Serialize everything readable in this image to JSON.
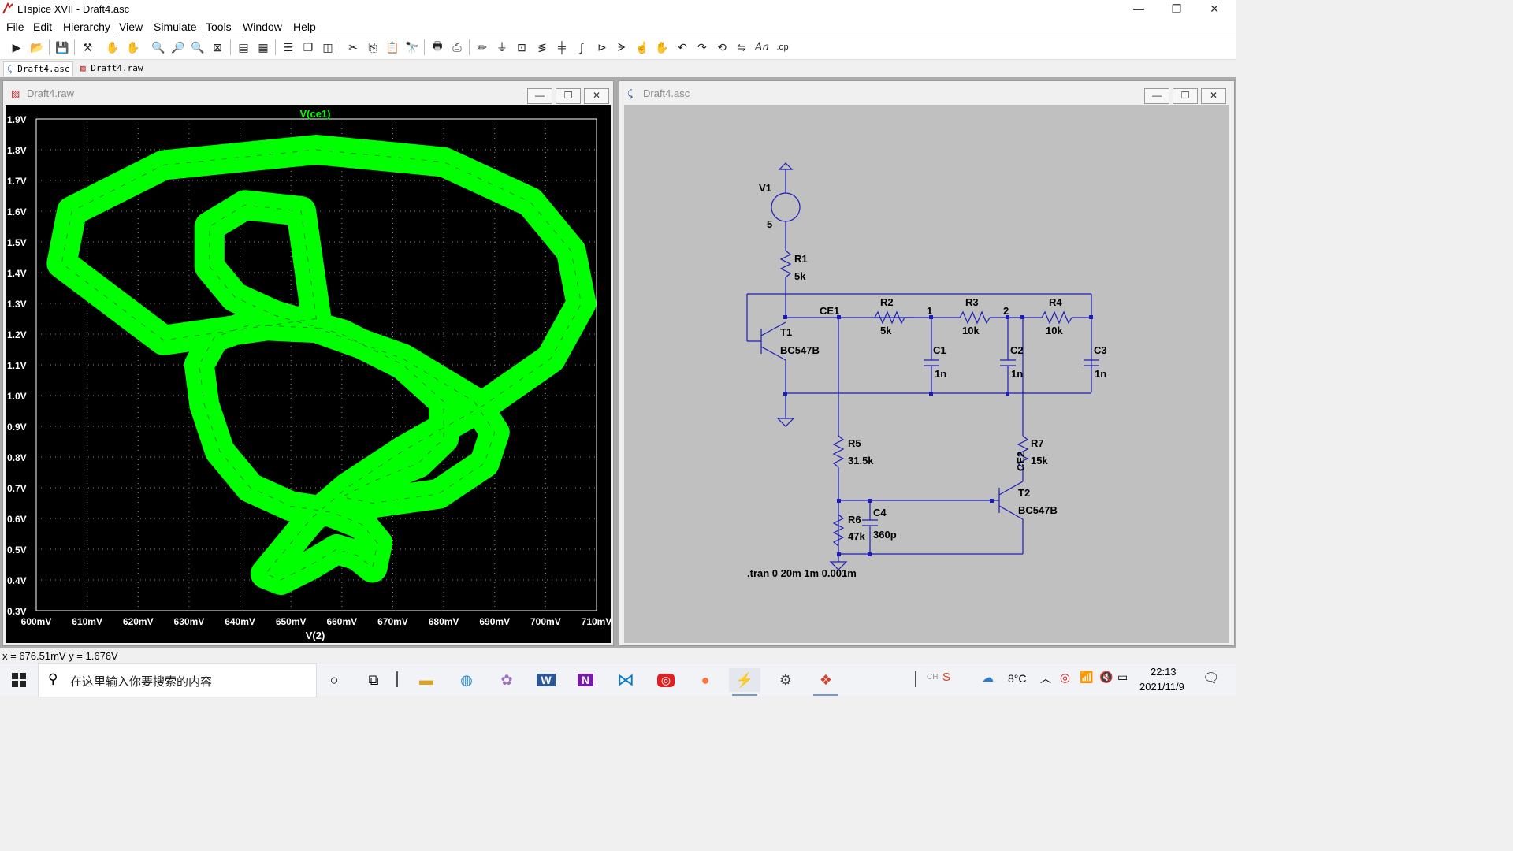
{
  "window": {
    "title": "LTspice XVII - Draft4.asc",
    "controls": [
      "—",
      "❐",
      "✕"
    ]
  },
  "menu": [
    {
      "key": "F",
      "rest": "ile"
    },
    {
      "key": "E",
      "rest": "dit"
    },
    {
      "key": "H",
      "rest": "ierarchy"
    },
    {
      "key": "V",
      "rest": "iew"
    },
    {
      "key": "S",
      "rest": "imulate"
    },
    {
      "key": "T",
      "rest": "ools"
    },
    {
      "key": "W",
      "rest": "indow"
    },
    {
      "key": "H",
      "rest": "elp"
    }
  ],
  "toolbar_icons": [
    "run-icon",
    "open-icon",
    "save-icon",
    "control-panel-icon",
    "halt-icon",
    "pan-icon",
    "zoom-in-icon",
    "zoom-to-fit-icon",
    "zoom-out-icon",
    "zoom-full-icon",
    "autorange-icon",
    "grid-icon",
    "tile-horizontal-icon",
    "cascade-icon",
    "tile-vertical-icon",
    "cut-icon",
    "copy-icon",
    "paste-icon",
    "find-icon",
    "print-icon",
    "print-setup-icon",
    "draw-wire-icon",
    "ground-icon",
    "label-net-icon",
    "place-resistor-icon",
    "place-capacitor-icon",
    "place-inductor-icon",
    "place-diode-icon",
    "place-component-icon",
    "move-icon",
    "drag-icon",
    "undo-icon",
    "redo-icon",
    "rotate-icon",
    "mirror-icon",
    "text-icon",
    "spice-directive-icon"
  ],
  "tabs": [
    {
      "label": "Draft4.asc",
      "active": true
    },
    {
      "label": "Draft4.raw",
      "active": false
    }
  ],
  "plot_window": {
    "title": "Draft4.raw",
    "trace": "V(ce1)",
    "trace_color": "#00ff00",
    "xlabel": "V(2)",
    "x_ticks": [
      "600mV",
      "610mV",
      "620mV",
      "630mV",
      "640mV",
      "650mV",
      "660mV",
      "670mV",
      "680mV",
      "690mV",
      "700mV",
      "710mV"
    ],
    "y_ticks": [
      "1.9V",
      "1.8V",
      "1.7V",
      "1.6V",
      "1.5V",
      "1.4V",
      "1.3V",
      "1.2V",
      "1.1V",
      "1.0V",
      "0.9V",
      "0.8V",
      "0.7V",
      "0.6V",
      "0.5V",
      "0.4V",
      "0.3V"
    ]
  },
  "chart_data": {
    "type": "line",
    "title": "V(ce1)",
    "xlabel": "V(2)",
    "ylabel": "",
    "xlim": [
      600,
      710
    ],
    "ylim": [
      0.3,
      1.9
    ],
    "x_unit": "mV",
    "y_unit": "V",
    "grid": true,
    "series": [
      {
        "name": "V(ce1)",
        "color": "#00ff00",
        "x": [
          655,
          625,
          605,
          607,
          625,
          655,
          680,
          697,
          705,
          707,
          701,
          688,
          672,
          661,
          654,
          649,
          645,
          648,
          654,
          659,
          663,
          666,
          667,
          664,
          658,
          650,
          642,
          636,
          633,
          632,
          635,
          642,
          655,
          672,
          686,
          690,
          688,
          679,
          666,
          660,
          666,
          675,
          680,
          680,
          672,
          660,
          647,
          639,
          634,
          634,
          641,
          652
        ],
        "y": [
          1.25,
          1.18,
          1.43,
          1.6,
          1.75,
          1.8,
          1.76,
          1.63,
          1.47,
          1.3,
          1.12,
          0.97,
          0.82,
          0.7,
          0.6,
          0.5,
          0.42,
          0.4,
          0.45,
          0.5,
          0.48,
          0.44,
          0.52,
          0.58,
          0.62,
          0.64,
          0.7,
          0.82,
          0.97,
          1.1,
          1.19,
          1.23,
          1.22,
          1.12,
          0.98,
          0.88,
          0.78,
          0.68,
          0.65,
          0.67,
          0.72,
          0.78,
          0.86,
          0.98,
          1.1,
          1.2,
          1.26,
          1.32,
          1.42,
          1.55,
          1.62,
          1.6
        ]
      }
    ]
  },
  "schematic_window": {
    "title": "Draft4.asc",
    "labels": {
      "v1": "V1",
      "v1_val": "5",
      "r1": "R1",
      "r1_val": "5k",
      "r2": "R2",
      "r2_val": "5k",
      "r3": "R3",
      "r3_val": "10k",
      "r4": "R4",
      "r4_val": "10k",
      "r5": "R5",
      "r5_val": "31.5k",
      "r6": "R6",
      "r6_val": "47k",
      "r7": "R7",
      "r7_val": "15k",
      "c1": "C1",
      "c1_val": "1n",
      "c2": "C2",
      "c2_val": "1n",
      "c3": "C3",
      "c3_val": "1n",
      "c4": "C4",
      "c4_val": "360p",
      "t1": "T1",
      "t1_model": "BC547B",
      "t2": "T2",
      "t2_model": "BC547B",
      "net_ce1": "CE1",
      "net_1": "1",
      "net_2": "2",
      "net_ce2": "CE2",
      "directive": ".tran 0 20m 1m 0.001m"
    }
  },
  "status": "x = 676.51mV   y = 1.676V",
  "taskbar": {
    "search_placeholder": "在这里输入你要搜索的内容",
    "temperature": "8°C",
    "time": "22:13",
    "date": "2021/11/9",
    "ime": "CH"
  }
}
